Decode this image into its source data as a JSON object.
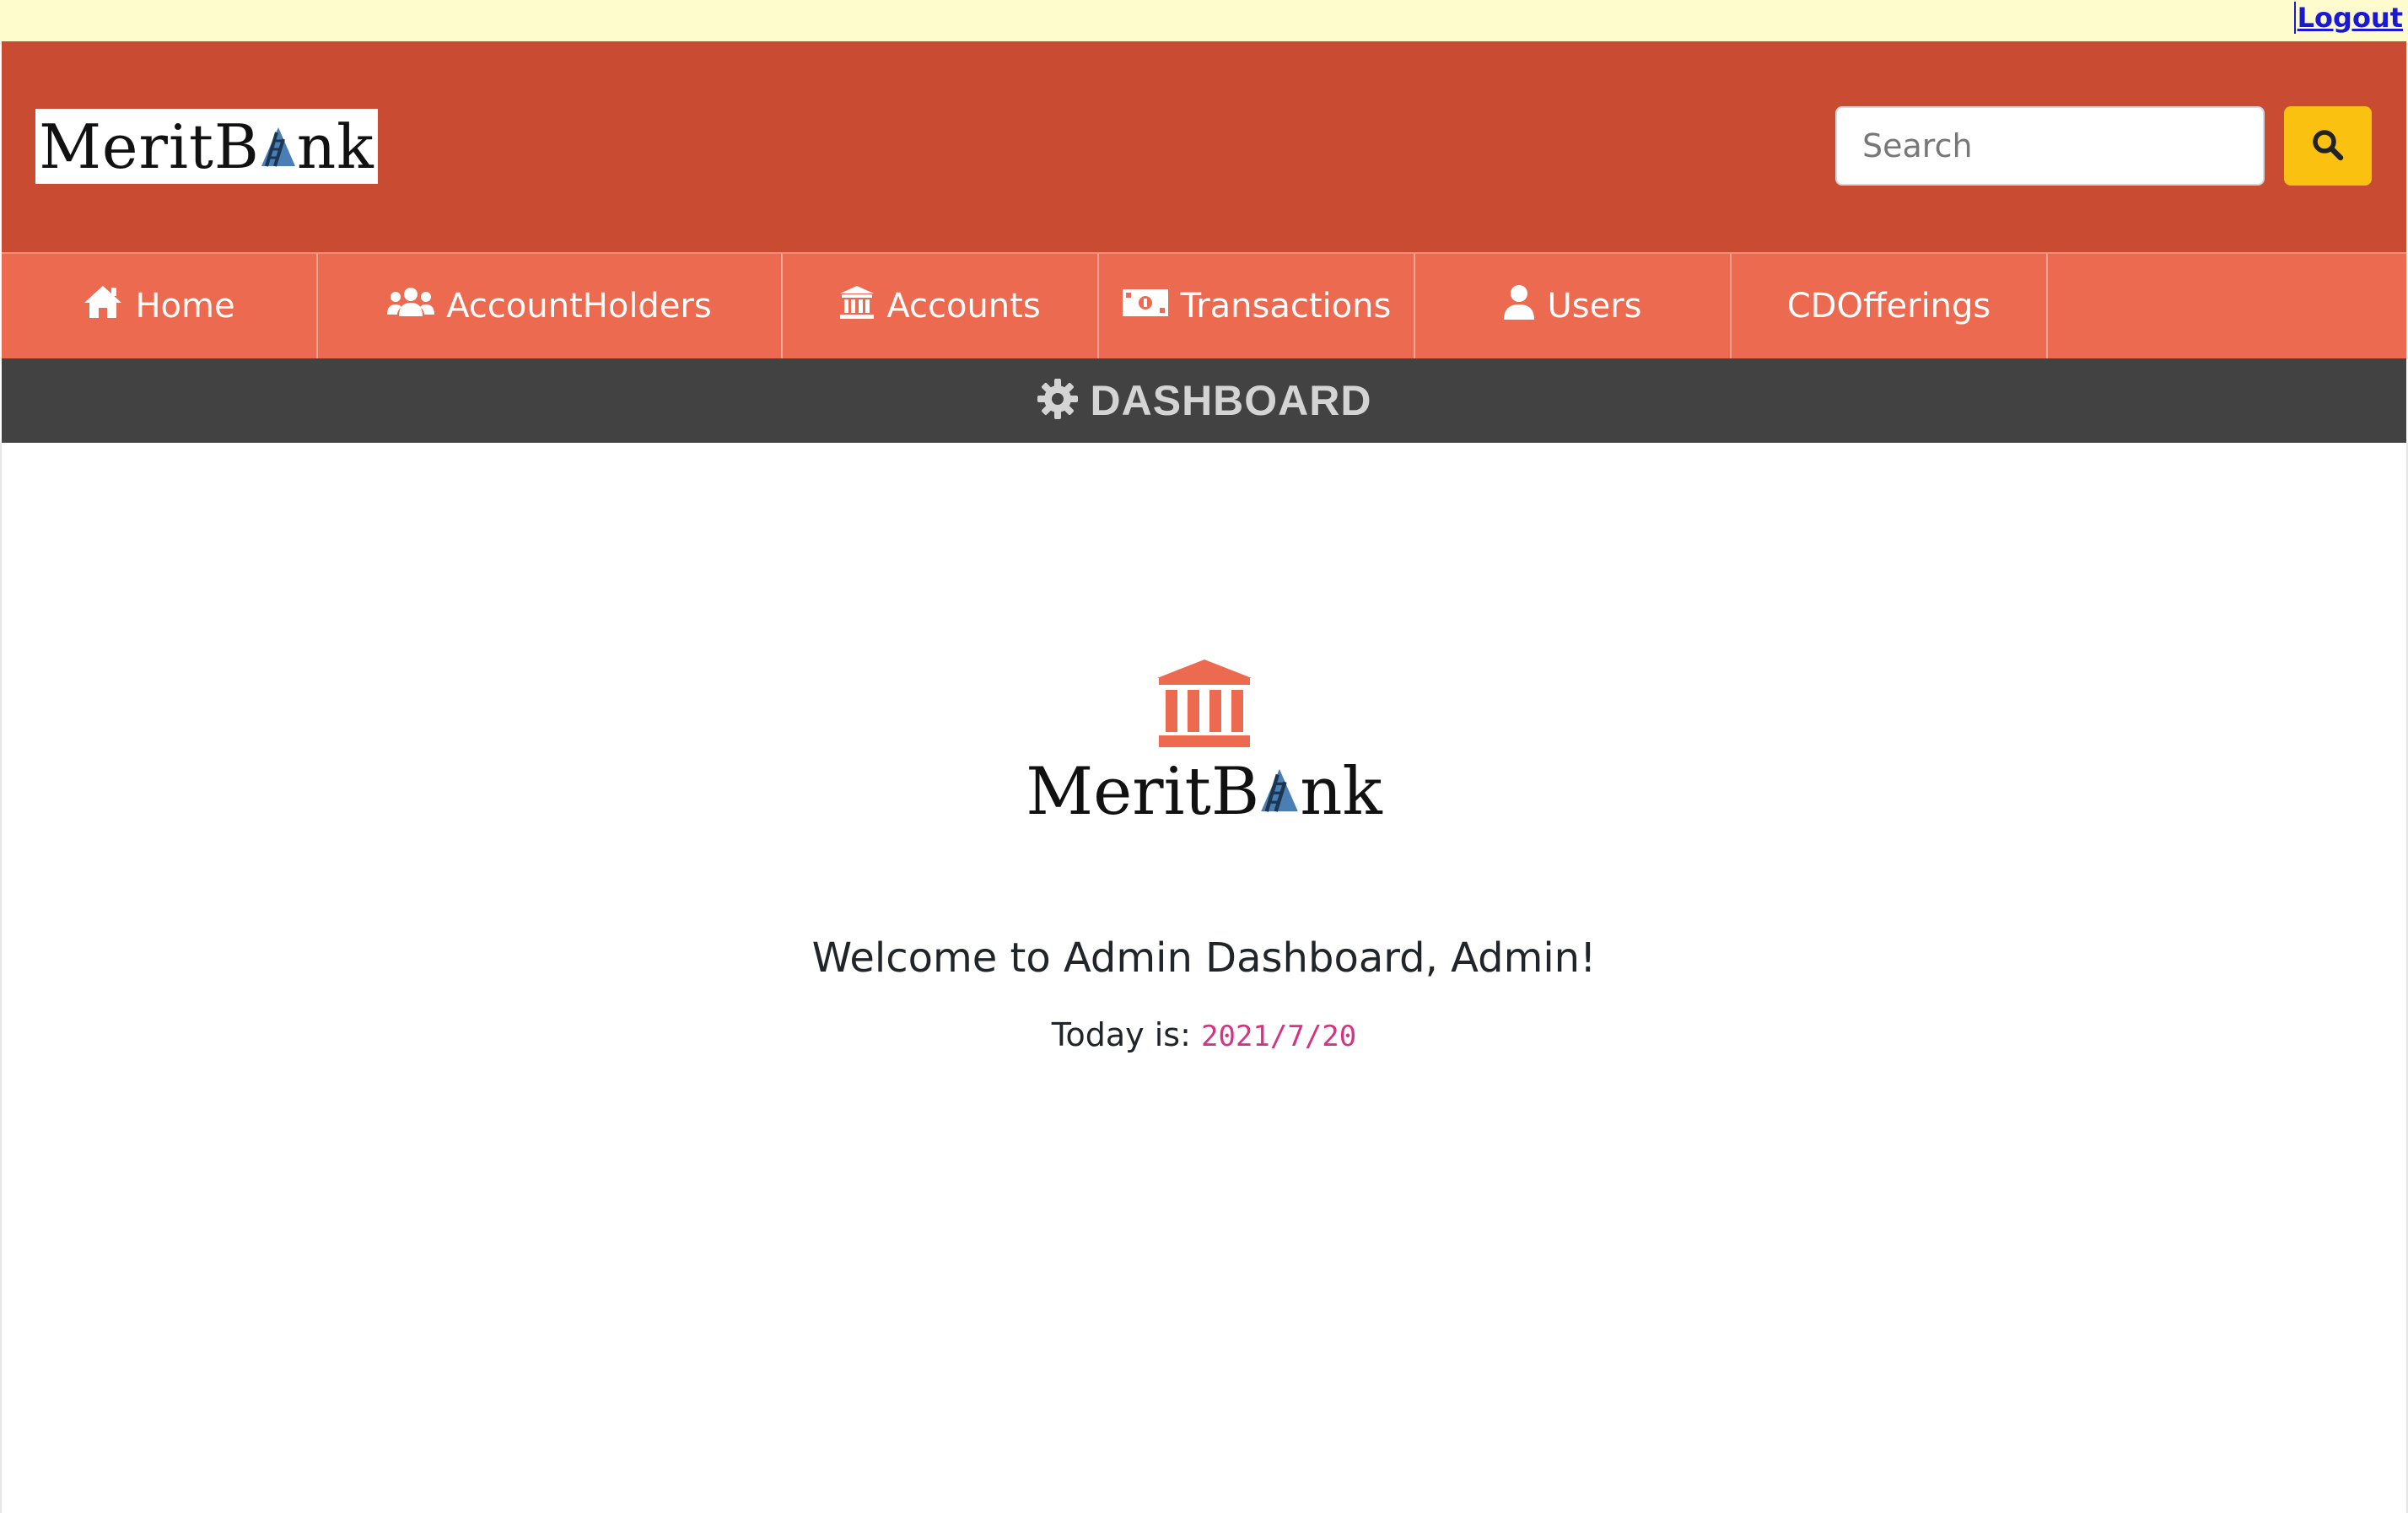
{
  "topbar": {
    "logout_label": "Logout"
  },
  "header": {
    "brand_prefix": "MeritB",
    "brand_suffix": "nk",
    "search": {
      "placeholder": "Search",
      "button_icon": "search-icon"
    }
  },
  "nav": {
    "items": [
      {
        "label": "Home",
        "icon": "home-icon"
      },
      {
        "label": "AccountHolders",
        "icon": "users-icon"
      },
      {
        "label": "Accounts",
        "icon": "bank-icon"
      },
      {
        "label": "Transactions",
        "icon": "money-bill-icon"
      },
      {
        "label": "Users",
        "icon": "user-icon"
      },
      {
        "label": "CDOfferings",
        "icon": ""
      }
    ]
  },
  "dashboard": {
    "title": "DASHBOARD",
    "icon": "gear-icon"
  },
  "main": {
    "brand_prefix": "MeritB",
    "brand_suffix": "nk",
    "welcome": "Welcome to Admin Dashboard, Admin!",
    "today_label": "Today is:",
    "today_date": "2021/7/20"
  },
  "colors": {
    "header": "#c84b32",
    "nav": "#eb6a50",
    "dashbar": "#424242",
    "search_button": "#fbc110",
    "accent_icon": "#eb6a50",
    "date": "#d63384",
    "topbar": "#fefccd"
  }
}
